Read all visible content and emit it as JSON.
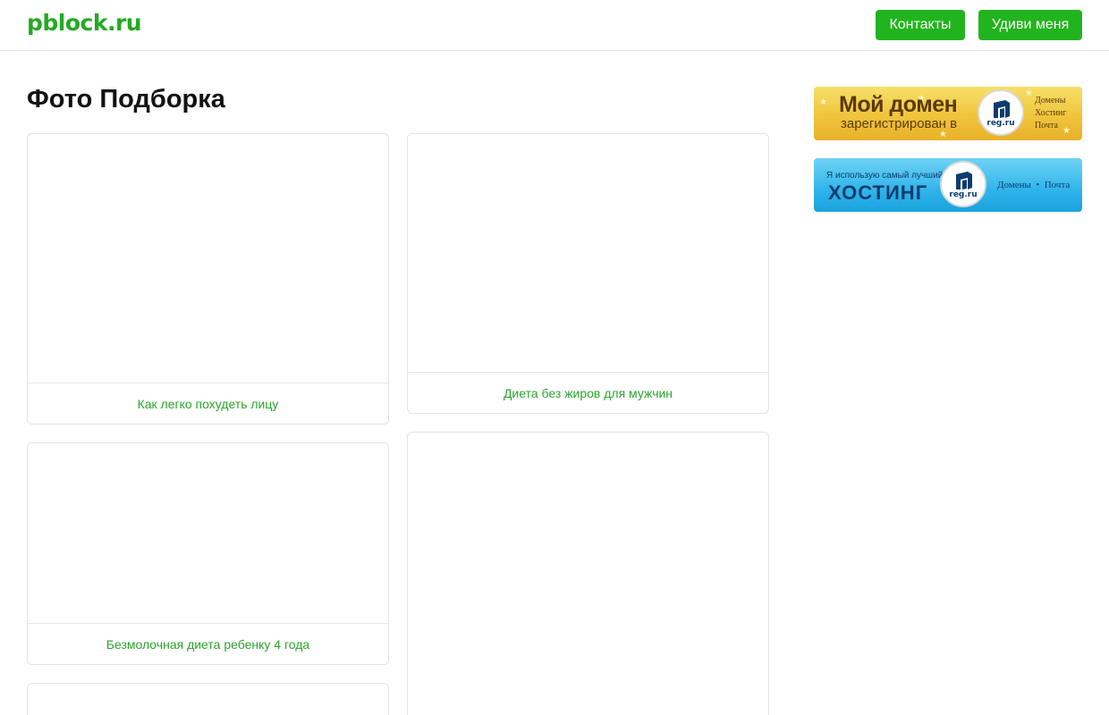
{
  "header": {
    "logo": "pblock.ru",
    "buttons": {
      "contacts": "Контакты",
      "surprise": "Удиви меня"
    }
  },
  "main": {
    "title": "Фото Подборка",
    "cards": [
      {
        "caption": "Как легко похудеть лицу"
      },
      {
        "caption": "Диета без жиров для мужчин"
      },
      {
        "caption": "Безмолочная диета ребенку 4 года"
      },
      {
        "caption": ""
      },
      {
        "caption": ""
      }
    ]
  },
  "sidebar": {
    "banner_domain": {
      "headline": "Мой домен",
      "subline": "зарегистрирован в",
      "logo_text": "reg.ru",
      "side_items": [
        "Домены",
        "Хостинг",
        "Почта"
      ]
    },
    "banner_hosting": {
      "subline": "Я использую самый лучший",
      "headline": "ХОСТИНГ",
      "logo_text": "reg.ru",
      "side_text": "Домены  •  Почта"
    }
  },
  "colors": {
    "accent_green": "#22b41e",
    "link_green": "#2aa52a",
    "banner_gold": "#f0c43c",
    "banner_blue": "#2fb4ea"
  }
}
